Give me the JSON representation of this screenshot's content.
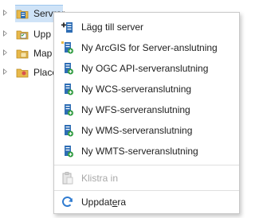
{
  "tree": {
    "items": [
      {
        "label": "Servrar",
        "selected": true
      },
      {
        "label": "Upp"
      },
      {
        "label": "Map"
      },
      {
        "label": "Place"
      }
    ]
  },
  "menu": {
    "items": [
      {
        "label": "Lägg till server",
        "icon": "add-server-icon"
      },
      {
        "label": "Ny ArcGIS for Server-anslutning",
        "icon": "new-arcgis-server-connection-icon"
      },
      {
        "label": "Ny OGC API-serveranslutning",
        "icon": "new-ogc-api-connection-icon"
      },
      {
        "label": "Ny WCS-serveranslutning",
        "icon": "new-wcs-connection-icon"
      },
      {
        "label": "Ny WFS-serveranslutning",
        "icon": "new-wfs-connection-icon"
      },
      {
        "label": "Ny WMS-serveranslutning",
        "icon": "new-wms-connection-icon"
      },
      {
        "label": "Ny WMTS-serveranslutning",
        "icon": "new-wmts-connection-icon"
      },
      {
        "label": "Klistra in",
        "icon": "paste-icon",
        "disabled": true
      },
      {
        "label_pre": "Uppdat",
        "label_mnemonic": "e",
        "label_post": "ra",
        "icon": "refresh-icon"
      }
    ]
  },
  "colors": {
    "selection": "#cfe3f7",
    "folder": "#e8b94a",
    "server_blue": "#2e6db4",
    "green_plus": "#2e9b3e",
    "refresh_blue": "#2f7bd0"
  }
}
